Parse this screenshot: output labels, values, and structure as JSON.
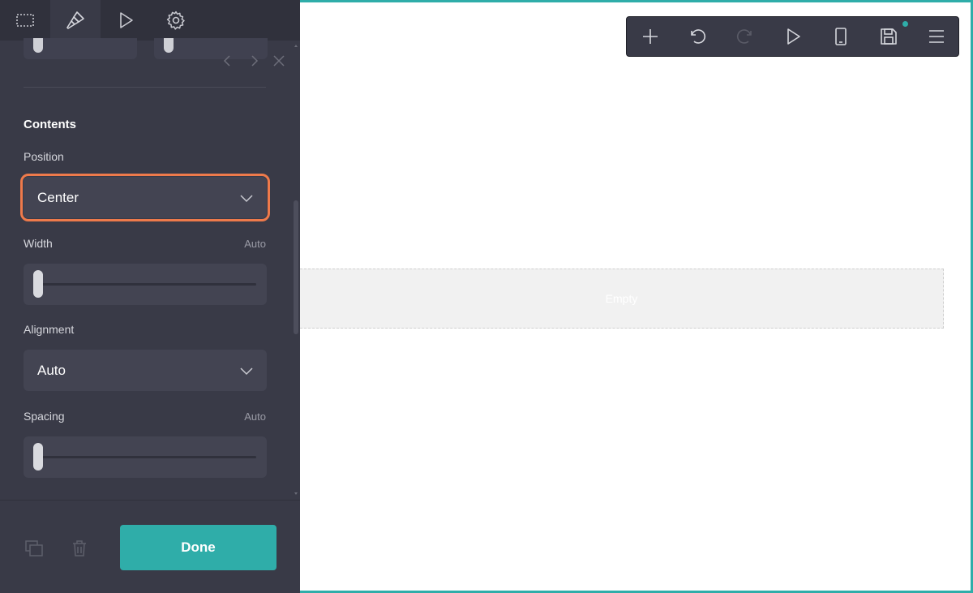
{
  "panel": {
    "tabs": [
      {
        "name": "select-tab",
        "icon": "selection-icon"
      },
      {
        "name": "design-tab",
        "icon": "brush-icon"
      },
      {
        "name": "preview-tab",
        "icon": "play-icon"
      },
      {
        "name": "settings-tab",
        "icon": "gear-icon"
      }
    ],
    "section_title": "Contents",
    "position": {
      "label": "Position",
      "value": "Center"
    },
    "width": {
      "label": "Width",
      "aux": "Auto",
      "level": 0
    },
    "alignment": {
      "label": "Alignment",
      "value": "Auto"
    },
    "spacing": {
      "label": "Spacing",
      "aux": "Auto",
      "level": 0
    },
    "done_label": "Done"
  },
  "toolbar": {
    "buttons": [
      "add-icon",
      "undo-icon",
      "redo-icon",
      "play-icon",
      "mobile-icon",
      "save-icon",
      "menu-icon"
    ]
  },
  "canvas": {
    "empty_label": "Empty"
  },
  "colors": {
    "accent": "#2fada9",
    "focus": "#ee7a4b",
    "panel_bg": "#393a47"
  }
}
